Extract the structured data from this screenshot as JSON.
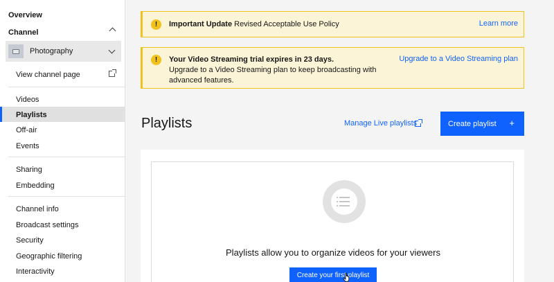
{
  "sidebar": {
    "overview": "Overview",
    "channel_heading": "Channel",
    "channel_select": {
      "value": "Photography"
    },
    "view_channel_page": "View channel page",
    "items": [
      {
        "label": "Videos"
      },
      {
        "label": "Playlists",
        "active": true
      },
      {
        "label": "Off-air"
      },
      {
        "label": "Events"
      },
      {
        "label": "Sharing"
      },
      {
        "label": "Embedding"
      },
      {
        "label": "Channel info"
      },
      {
        "label": "Broadcast settings"
      },
      {
        "label": "Security"
      },
      {
        "label": "Geographic filtering"
      },
      {
        "label": "Interactivity"
      }
    ]
  },
  "banners": [
    {
      "title": "Important Update",
      "text": "Revised Acceptable Use Policy",
      "link": "Learn more"
    },
    {
      "title": "Your Video Streaming trial expires in 23 days.",
      "text": "Upgrade to a Video Streaming plan to keep broadcasting with advanced features.",
      "link": "Upgrade to a Video Streaming plan"
    }
  ],
  "header": {
    "title": "Playlists",
    "manage_link": "Manage Live playlists",
    "create_button": "Create playlist"
  },
  "empty_state": {
    "message": "Playlists allow you to organize videos for your viewers",
    "button": "Create your first playlist"
  },
  "colors": {
    "accent": "#0f62fe",
    "warning_bg": "#fcf4d6",
    "warning_border": "#f1c21b"
  }
}
